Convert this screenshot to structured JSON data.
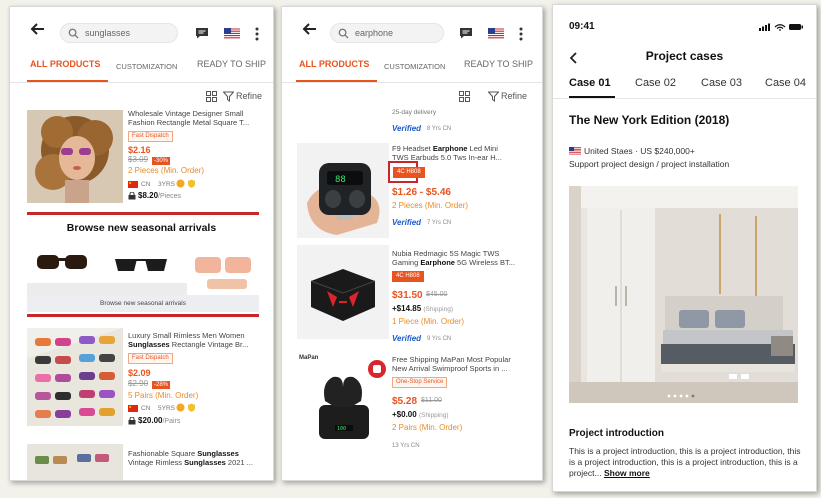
{
  "screen1": {
    "search_text": "sunglasses",
    "tabs": [
      "ALL PRODUCTS",
      "CUSTOMIZATION",
      "READY TO SHIP"
    ],
    "refine": "Refine",
    "product1": {
      "title_line1": "Wholesale Vintage Designer Small",
      "title_line2": "Fashion Rectangle Metal Square T...",
      "badge": "Fast Dispatch",
      "price": "$2.16",
      "old_price": "$3.09",
      "discount": "-30%",
      "moq": "2 Pieces",
      "moq_suffix": "(Min. Order)",
      "country": "CN",
      "years": "3YRS",
      "ship": "$8.20",
      "ship_suffix": "/Pieces"
    },
    "section_title": "Browse new seasonal arrivals",
    "section_button": "Browse new seasonal arrivals",
    "product2": {
      "title_line1": "Luxury Small Rimless Men Women",
      "title_line2_bold": "Sunglasses",
      "title_line2_rest": " Rectangle Vintage Br...",
      "badge": "Fast Dispatch",
      "price": "$2.09",
      "old_price": "$2.90",
      "discount": "-28%",
      "moq": "5 Pairs",
      "moq_suffix": "(Min. Order)",
      "country": "CN",
      "years": "5YRS",
      "ship": "$20.00",
      "ship_suffix": "/Pairs"
    },
    "product3": {
      "title_line1_pre": "Fashionable Square ",
      "title_line1_bold": "Sunglasses",
      "title_line2_pre": "Vintage Rimless ",
      "title_line2_bold": "Sunglasses",
      "title_line2_rest": " 2021 ..."
    }
  },
  "screen2": {
    "search_text": "earphone",
    "tabs": [
      "ALL PRODUCTS",
      "CUSTOMIZATION",
      "READY TO SHIP"
    ],
    "refine": "Refine",
    "delivery_text": "25-day delivery",
    "verified": "Verified",
    "verified_sub1": "8 Yrs CN",
    "product1": {
      "title_line1_pre": "F9 Headset ",
      "title_line1_bold": "Earphone",
      "title_line1_rest": " Led Mini",
      "title_line2": "TWS Earbuds 5.0 Tws In-ear H...",
      "badge": "4C H808",
      "price": "$1.26 - $5.46",
      "moq": "2 Pieces",
      "moq_suffix": "(Min. Order)",
      "verified_sub": "7 Yrs CN"
    },
    "product2": {
      "title_line1": "Nubia Redmagic 5S Magic TWS",
      "title_line2_pre": "Gaming ",
      "title_line2_bold": "Earphone",
      "title_line2_rest": " 5G Wireless BT...",
      "badge": "4C H808",
      "price": "$31.50",
      "old_price": "$45.00",
      "ship": "+$14.85",
      "ship_suffix": "(Shipping)",
      "moq": "1 Piece",
      "moq_suffix": "(Min. Order)",
      "verified_sub": "9 Yrs CN"
    },
    "product3": {
      "logo": "MaPan",
      "title_line1": "Free Shipping MaPan Most Popular",
      "title_line2": "New Arrival Swimproof Sports in ...",
      "badge": "One-Stop Service",
      "price": "$5.28",
      "old_price": "$11.00",
      "ship": "+$0.00",
      "ship_suffix": "(Shipping)",
      "moq": "2 Pairs",
      "moq_suffix": "(Min. Order)",
      "years": "13 Yrs CN"
    }
  },
  "screen3": {
    "time": "09:41",
    "title": "Project cases",
    "case_tabs": [
      "Case 01",
      "Case 02",
      "Case 03",
      "Case 04"
    ],
    "edition": "The New York Edition (2018)",
    "location": "United Staes · US $240,000+",
    "support": "Support project design / project installation",
    "intro_heading": "Project introduction",
    "intro_text": "This is a project introduction, this is a project introduction, this is a project introduction, this is a project introduction, this is a project... ",
    "show_more": "Show more"
  },
  "colors": {
    "accent": "#e8541f",
    "verified": "#1d5bcc",
    "section_red": "#c7272a",
    "moq": "#e88b27"
  }
}
